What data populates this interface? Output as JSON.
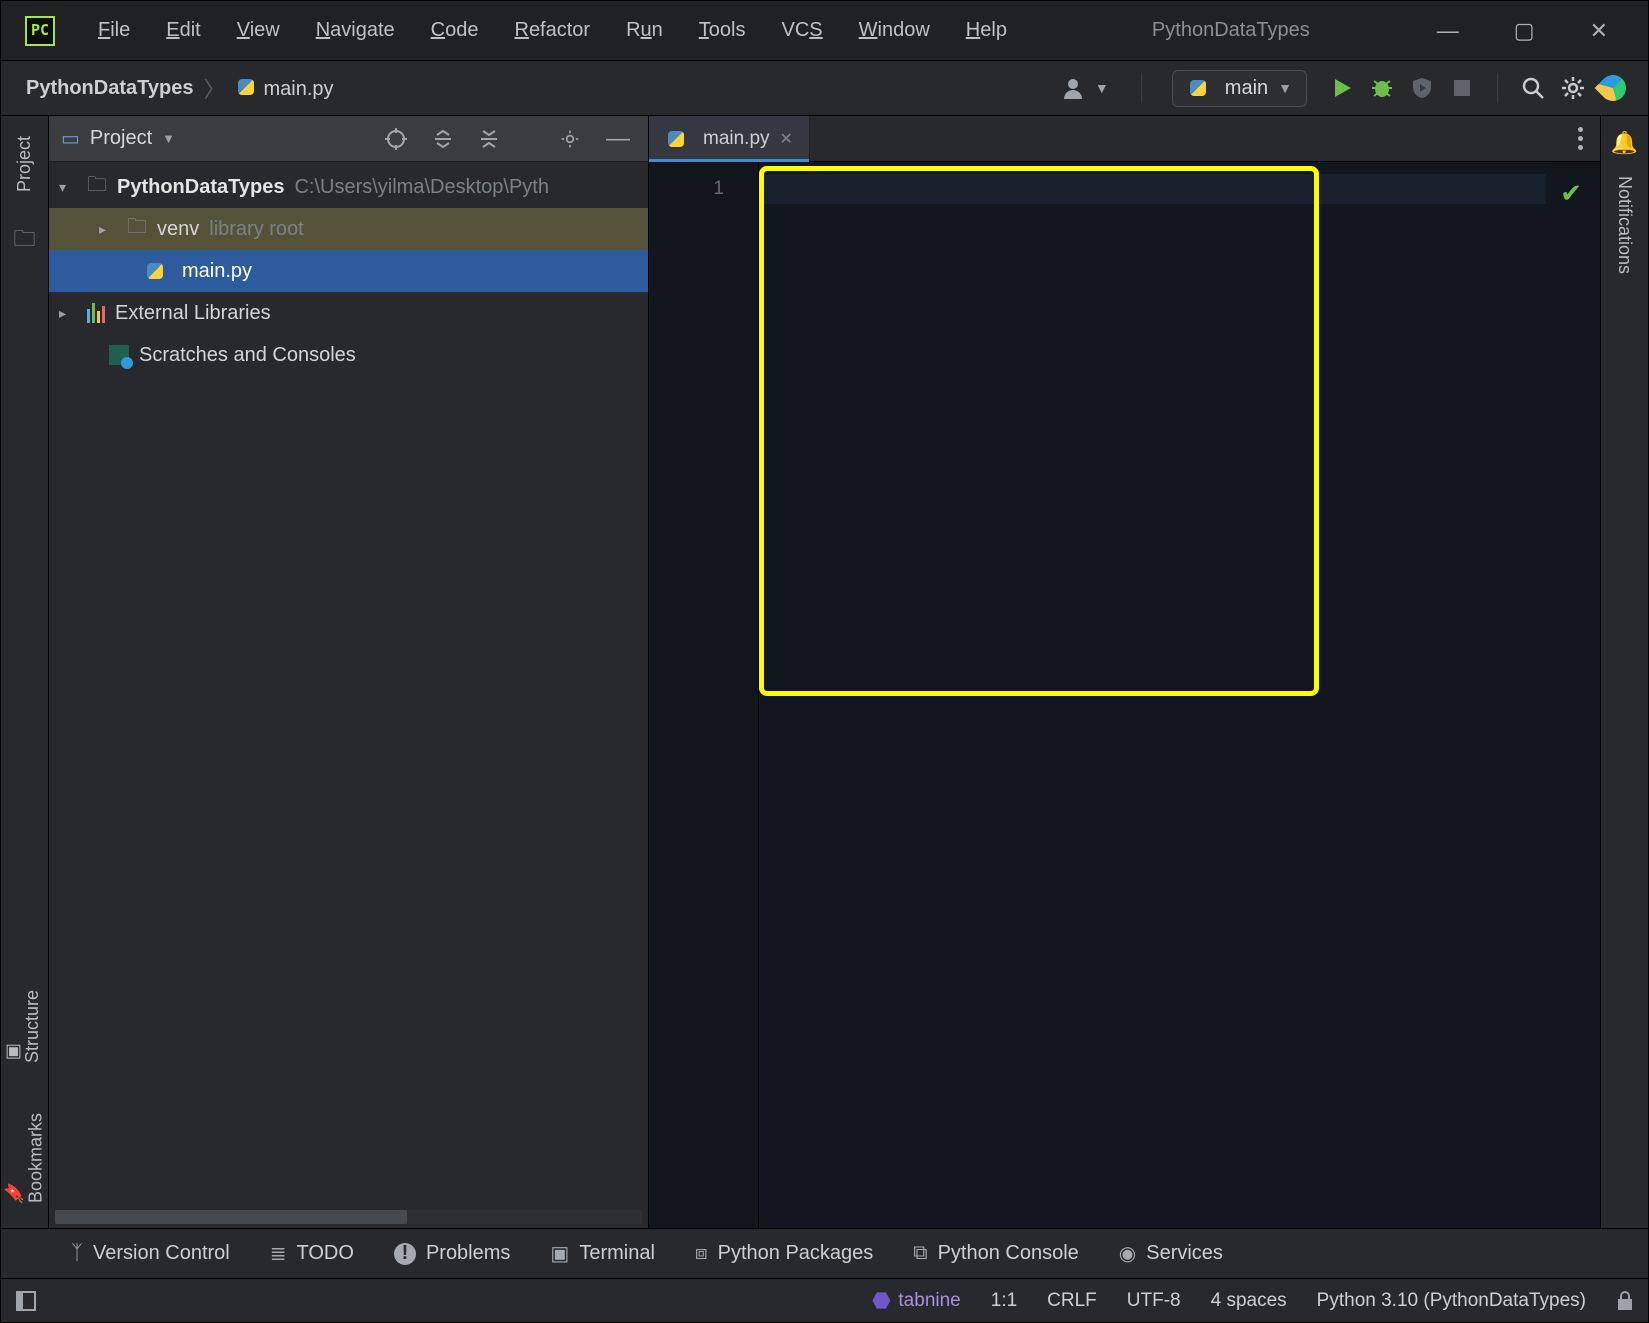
{
  "menu": {
    "file": "File",
    "edit": "Edit",
    "view": "View",
    "navigate": "Navigate",
    "code": "Code",
    "refactor": "Refactor",
    "run": "Run",
    "tools": "Tools",
    "vcs": "VCS",
    "window": "Window",
    "help": "Help"
  },
  "title_project": "PythonDataTypes",
  "breadcrumbs": {
    "root": "PythonDataTypes",
    "file": "main.py"
  },
  "run_config": {
    "label": "main"
  },
  "project_panel": {
    "header": "Project",
    "root": {
      "name": "PythonDataTypes",
      "path": "C:\\Users\\yilma\\Desktop\\Pyth"
    },
    "venv": {
      "name": "venv",
      "hint": "library root"
    },
    "mainfile": "main.py",
    "external": "External Libraries",
    "scratches": "Scratches and Consoles"
  },
  "editor": {
    "tab": "main.py",
    "line": "1"
  },
  "left_gutter": {
    "project": "Project",
    "structure": "Structure",
    "bookmarks": "Bookmarks"
  },
  "right_gutter": {
    "notifications": "Notifications"
  },
  "bottom": {
    "vcs": "Version Control",
    "todo": "TODO",
    "problems": "Problems",
    "terminal": "Terminal",
    "pypkg": "Python Packages",
    "pyconsole": "Python Console",
    "services": "Services"
  },
  "status": {
    "tabnine": "tabnine",
    "pos": "1:1",
    "eol": "CRLF",
    "enc": "UTF-8",
    "indent": "4 spaces",
    "interp": "Python 3.10 (PythonDataTypes)"
  },
  "colors": {
    "highlight": "#fdfd00"
  }
}
